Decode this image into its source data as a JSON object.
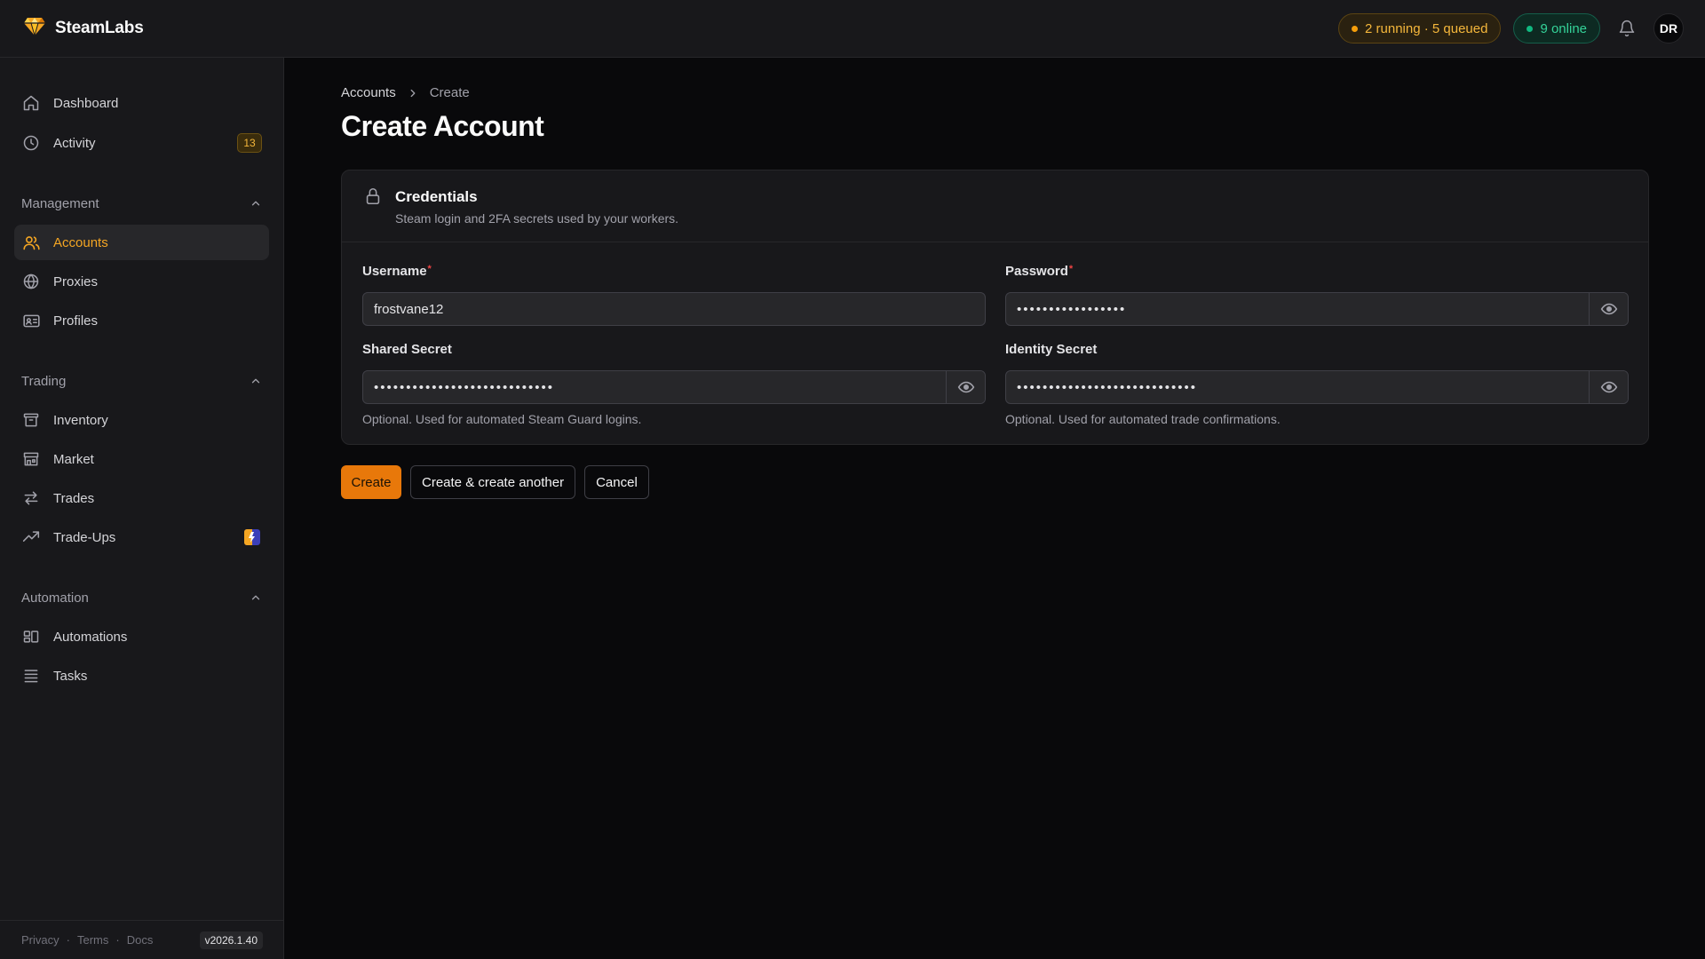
{
  "app": {
    "brand_name": "SteamLabs",
    "accent_color": "#e8780a"
  },
  "header": {
    "queue_status": "2 running · 5 queued",
    "online_status": "9 online",
    "avatar_initials": "DR"
  },
  "sidebar": {
    "top_items": [
      {
        "label": "Dashboard",
        "icon": "home-icon"
      },
      {
        "label": "Activity",
        "icon": "clock-icon",
        "badge": "13"
      }
    ],
    "sections": [
      {
        "title": "Management",
        "items": [
          {
            "label": "Accounts",
            "icon": "users-icon",
            "active": true
          },
          {
            "label": "Proxies",
            "icon": "globe-icon"
          },
          {
            "label": "Profiles",
            "icon": "id-card-icon"
          }
        ]
      },
      {
        "title": "Trading",
        "items": [
          {
            "label": "Inventory",
            "icon": "archive-icon"
          },
          {
            "label": "Market",
            "icon": "store-icon"
          },
          {
            "label": "Trades",
            "icon": "arrows-swap-icon"
          },
          {
            "label": "Trade-Ups",
            "icon": "trending-up-icon"
          }
        ]
      },
      {
        "title": "Automation",
        "items": [
          {
            "label": "Automations",
            "icon": "layout-icon"
          },
          {
            "label": "Tasks",
            "icon": "list-icon"
          }
        ]
      }
    ],
    "footer": {
      "links": [
        "Privacy",
        "Terms",
        "Docs"
      ],
      "version": "v2026.1.40"
    }
  },
  "main": {
    "breadcrumb": [
      "Accounts",
      "Create"
    ],
    "page_title": "Create Account",
    "card": {
      "title": "Credentials",
      "subtitle": "Steam login and 2FA secrets used by your workers.",
      "fields": {
        "username": {
          "label": "Username",
          "value": "frostvane12",
          "required": true
        },
        "password": {
          "label": "Password",
          "masked_value": "•••••••••••••••••",
          "required": true
        },
        "shared_secret": {
          "label": "Shared Secret",
          "masked_value": "••••••••••••••••••••••••••••",
          "hint": "Optional. Used for automated Steam Guard logins."
        },
        "identity_secret": {
          "label": "Identity Secret",
          "masked_value": "••••••••••••••••••••••••••••",
          "hint": "Optional. Used for automated trade confirmations."
        }
      }
    },
    "actions": {
      "create": "Create",
      "create_another": "Create & create another",
      "cancel": "Cancel"
    }
  }
}
